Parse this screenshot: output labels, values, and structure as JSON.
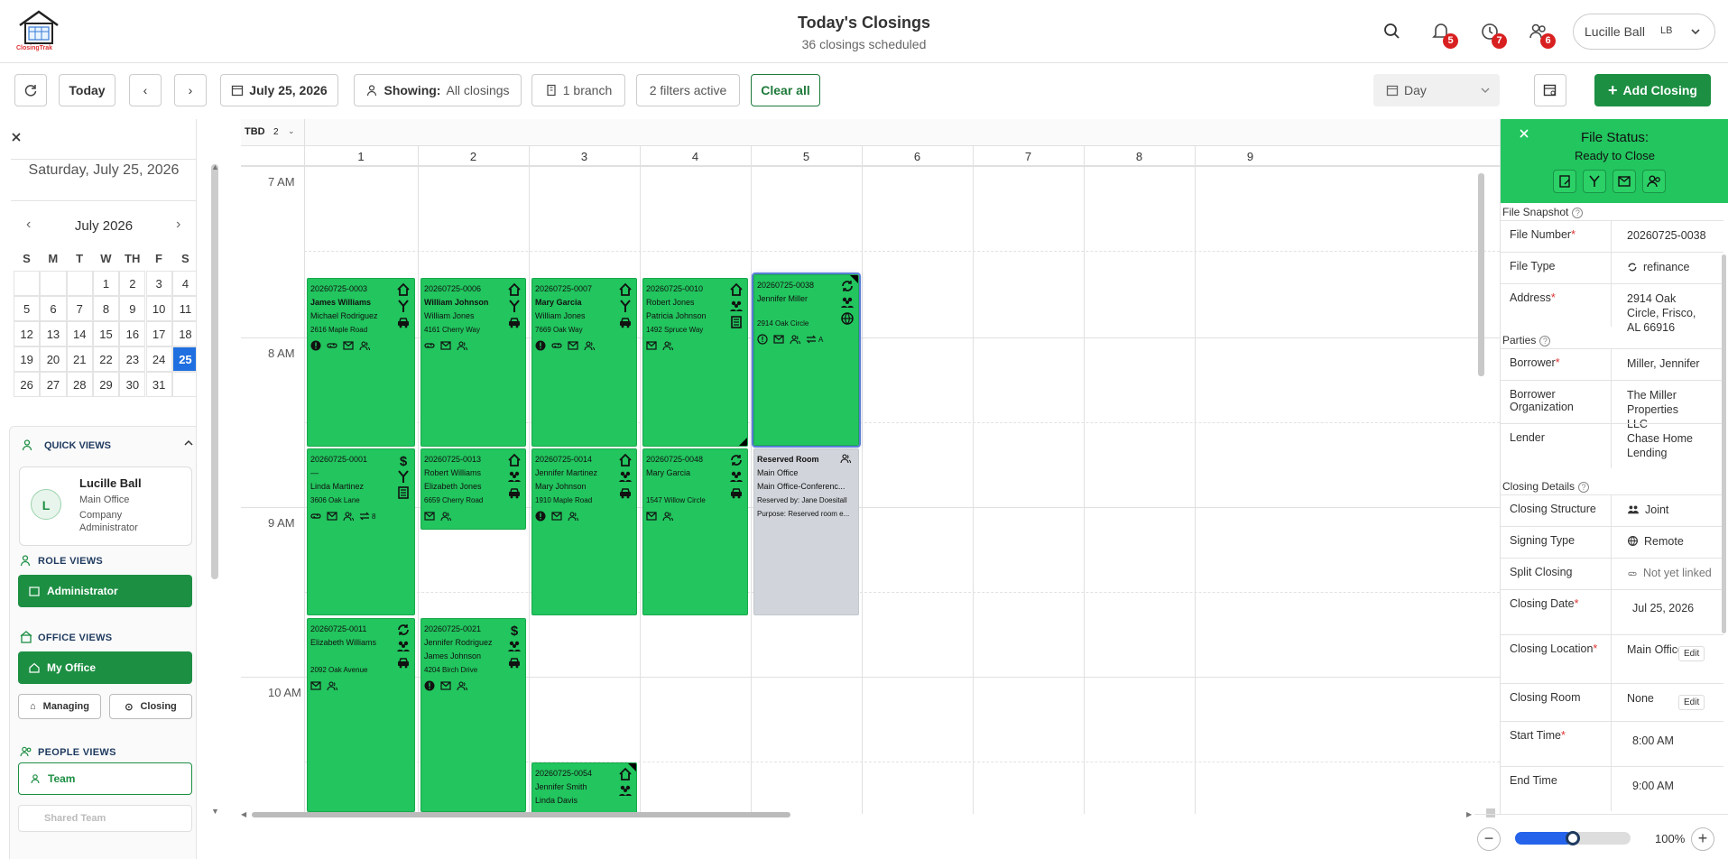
{
  "header": {
    "logo_text": "ClosingTrak",
    "title": "Today's Closings",
    "subtitle": "36 closings scheduled",
    "notifications": "5",
    "reminders": "7",
    "people": "6",
    "user_name": "Lucille Ball",
    "user_initials": "LB"
  },
  "toolbar": {
    "today": "Today",
    "date": "July 25, 2026",
    "showing_label": "Showing:",
    "showing_value": "All closings",
    "branch": "1 branch",
    "filters": "2  filters active",
    "clear": "Clear all",
    "view": "Day",
    "add": "Add Closing"
  },
  "sidebar": {
    "date": "Saturday, July 25, 2026",
    "month": "July 2026",
    "dow": [
      "S",
      "M",
      "T",
      "W",
      "TH",
      "F",
      "S"
    ],
    "weeks": [
      [
        "",
        "",
        "",
        "1",
        "2",
        "3",
        "4"
      ],
      [
        "5",
        "6",
        "7",
        "8",
        "9",
        "10",
        "11"
      ],
      [
        "12",
        "13",
        "14",
        "15",
        "16",
        "17",
        "18"
      ],
      [
        "19",
        "20",
        "21",
        "22",
        "23",
        "24",
        "25"
      ],
      [
        "26",
        "27",
        "28",
        "29",
        "30",
        "31",
        ""
      ]
    ],
    "selected_day": "25",
    "quick_views": "QUICK VIEWS",
    "profile_initial": "L",
    "profile_name": "Lucille Ball",
    "profile_office": "Main Office",
    "profile_role": "Company Administrator",
    "role_views": "ROLE VIEWS",
    "role_btn": "Administrator",
    "office_views": "OFFICE VIEWS",
    "office_btn": "My Office",
    "managing": "Managing",
    "closing": "Closing",
    "people_views": "PEOPLE VIEWS",
    "team": "Team",
    "shared_team": "Shared Team"
  },
  "calendar": {
    "tbd": "TBD",
    "tbd_count": "2",
    "columns": [
      "1",
      "2",
      "3",
      "4",
      "5",
      "6",
      "7",
      "8",
      "9"
    ],
    "times": [
      "7 AM",
      "8 AM",
      "9 AM",
      "10 AM"
    ],
    "cards": [
      {
        "id": "20260725-0003",
        "p1": "James Williams",
        "p2": "Michael Rodriguez",
        "addr": "2616 Maple Road"
      },
      {
        "id": "20260725-0006",
        "p1": "William Johnson",
        "p2": "William Jones",
        "addr": "4161 Cherry Way"
      },
      {
        "id": "20260725-0007",
        "p1": "Mary Garcia",
        "p2": "William Jones",
        "addr": "7669 Oak Way"
      },
      {
        "id": "20260725-0010",
        "p1": "Robert Jones",
        "p2": "Patricia Johnson",
        "addr": "1492 Spruce Way"
      },
      {
        "id": "20260725-0038",
        "p1": "Jennifer Miller",
        "p2": "",
        "addr": "2914 Oak Circle",
        "badge": "A"
      },
      {
        "id": "20260725-0001",
        "p1": "—",
        "p2": "Linda Martinez",
        "addr": "3606 Oak Lane",
        "badge": "8"
      },
      {
        "id": "20260725-0013",
        "p1": "Robert Williams",
        "p2": "Elizabeth Jones",
        "addr": "6659 Cherry Road"
      },
      {
        "id": "20260725-0014",
        "p1": "Jennifer Martinez",
        "p2": "Mary Johnson",
        "addr": "1910 Maple Road"
      },
      {
        "id": "20260725-0048",
        "p1": "Mary Garcia",
        "p2": "",
        "addr": "1547 Willow Circle"
      },
      {
        "id": "20260725-0011",
        "p1": "Elizabeth Williams",
        "p2": "",
        "addr": "2092 Oak Avenue"
      },
      {
        "id": "20260725-0021",
        "p1": "Jennifer Rodriguez",
        "p2": "James Johnson",
        "addr": "4204 Birch Drive"
      },
      {
        "id": "20260725-0054",
        "p1": "Jennifer Smith",
        "p2": "Linda Davis",
        "addr": ""
      }
    ],
    "reserved": {
      "title": "Reserved Room",
      "office": "Main Office",
      "room": "Main Office-Conferenc...",
      "by": "Reserved by: Jane Doesitall",
      "purpose": "Purpose: Reserved room e..."
    }
  },
  "panel": {
    "status_label": "File Status:",
    "status_value": "Ready to Close",
    "snapshot": "File Snapshot",
    "file_number_k": "File Number",
    "file_number_v": "20260725-0038",
    "file_type_k": "File Type",
    "file_type_v": "refinance",
    "address_k": "Address",
    "address_v": "2914 Oak Circle, Frisco, AL 66916",
    "parties": "Parties",
    "borrower_k": "Borrower",
    "borrower_v": "Miller, Jennifer",
    "borrower_org_k": "Borrower Organization",
    "borrower_org_v": "The Miller Properties LLC",
    "lender_k": "Lender",
    "lender_v": "Chase Home Lending",
    "details": "Closing Details",
    "structure_k": "Closing Structure",
    "structure_v": "Joint",
    "signing_k": "Signing Type",
    "signing_v": "Remote",
    "split_k": "Split Closing",
    "split_v": "Not yet linked",
    "date_k": "Closing Date",
    "date_v": "Jul 25, 2026",
    "location_k": "Closing Location",
    "location_v": "Main Office",
    "room_k": "Closing Room",
    "room_v": "None",
    "start_k": "Start Time",
    "start_v": "8:00 AM",
    "end_k": "End Time",
    "end_v": "9:00 AM",
    "edit": "Edit"
  },
  "zoom": {
    "value": "100%",
    "level": 0.5
  },
  "colors": {
    "card": "#22c55e",
    "accent": "#1d8f43",
    "selected": "#1f6fe0",
    "badge": "#d92020"
  }
}
